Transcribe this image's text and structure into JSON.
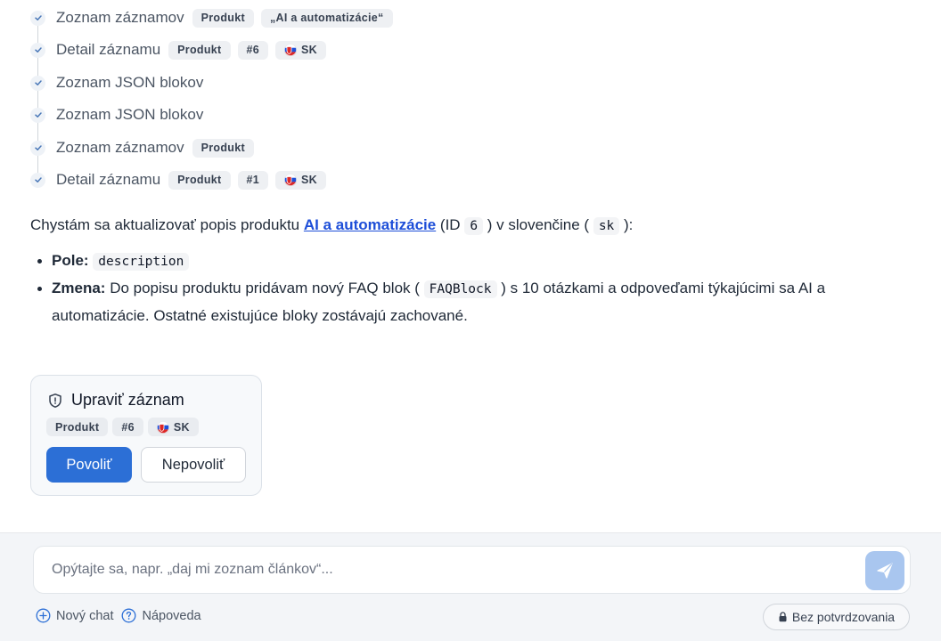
{
  "steps": [
    {
      "label": "Zoznam záznamov",
      "chips": [
        {
          "text": "Produkt"
        },
        {
          "text": "„AI a automatizácie“"
        }
      ]
    },
    {
      "label": "Detail záznamu",
      "chips": [
        {
          "text": "Produkt"
        },
        {
          "text": "#6"
        },
        {
          "text": "SK",
          "flag": true
        }
      ]
    },
    {
      "label": "Zoznam JSON blokov",
      "chips": []
    },
    {
      "label": "Zoznam JSON blokov",
      "chips": []
    },
    {
      "label": "Zoznam záznamov",
      "chips": [
        {
          "text": "Produkt"
        }
      ]
    },
    {
      "label": "Detail záznamu",
      "chips": [
        {
          "text": "Produkt"
        },
        {
          "text": "#1"
        },
        {
          "text": "SK",
          "flag": true
        }
      ]
    }
  ],
  "message": {
    "intro_before": "Chystám sa aktualizovať popis produktu ",
    "product_link": "AI a automatizácie",
    "intro_mid1": " (ID ",
    "id_code": "6",
    "intro_mid2": " ) v slovenčine ( ",
    "lang_code": "sk",
    "intro_after": " ):",
    "bullets": {
      "field_label": "Pole:",
      "field_value": "description",
      "change_label": "Zmena:",
      "change_text1": " Do popisu produktu pridávam nový FAQ blok ( ",
      "change_code": "FAQBlock",
      "change_text2": " ) s 10 otázkami a odpoveďami týkajúcimi sa AI a",
      "change_text3": "automatizácie. Ostatné existujúce bloky zostávajú zachované."
    }
  },
  "approval": {
    "title": "Upraviť záznam",
    "chips": [
      "Produkt",
      "#6",
      "SK"
    ],
    "allow_label": "Povoliť",
    "deny_label": "Nepovoliť"
  },
  "composer": {
    "placeholder": "Opýtajte sa, napr. „daj mi zoznam článkov“...",
    "new_chat": "Nový chat",
    "help": "Nápoveda",
    "mode_badge": "Bez potvrdzovania"
  },
  "colors": {
    "primary": "#2c6fd6",
    "link": "#1d4ed8",
    "send_disabled": "#a9c6ef"
  }
}
